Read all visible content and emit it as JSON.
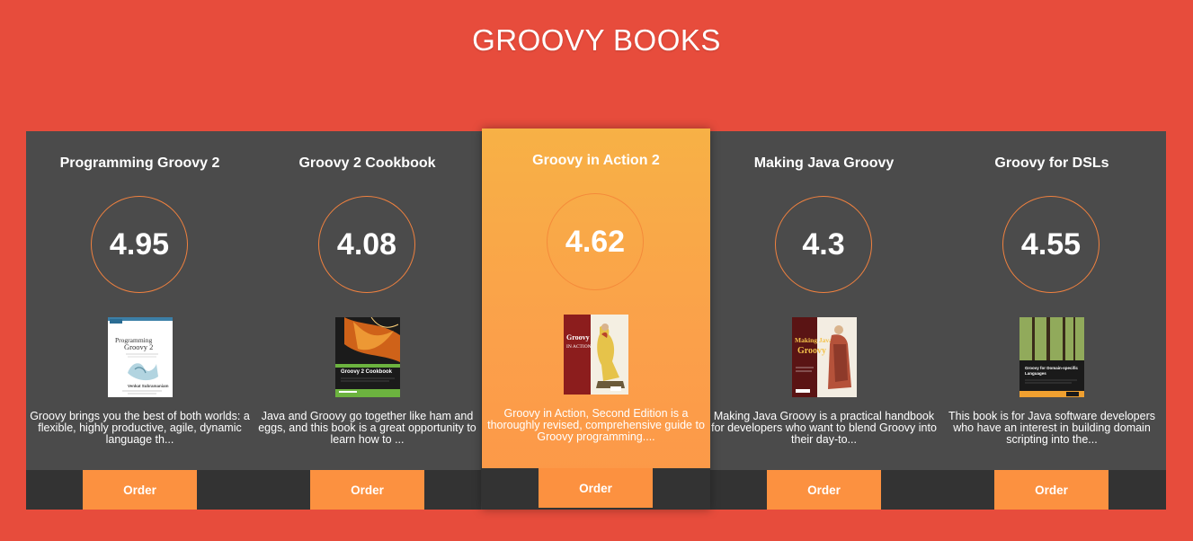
{
  "page": {
    "title": "GROOVY BOOKS"
  },
  "colors": {
    "background": "#e74c3c",
    "card": "#4b4b4b",
    "card_featured_top": "#f7b146",
    "card_featured_bottom": "#fd9748",
    "accent": "#fc9140",
    "bar": "#333333"
  },
  "books": [
    {
      "title": "Programming Groovy 2",
      "rating": "4.95",
      "description": "Groovy brings you the best of both worlds: a flexible, highly productive, agile, dynamic language th...",
      "order_label": "Order",
      "cover": {
        "lines": [
          "Programming",
          "Groovy 2"
        ],
        "author": "Venkat Subramaniam"
      }
    },
    {
      "title": "Groovy 2 Cookbook",
      "rating": "4.08",
      "description": "Java and Groovy go together like ham and eggs, and this book is a great opportunity to learn how to ...",
      "order_label": "Order",
      "cover": {
        "lines": [
          "Groovy 2 Cookbook"
        ]
      }
    },
    {
      "title": "Groovy in Action 2",
      "rating": "4.62",
      "description": "Groovy in Action, Second Edition is a thoroughly revised, comprehensive guide to Groovy programming....",
      "order_label": "Order",
      "cover": {
        "lines": [
          "Groovy",
          "IN ACTION"
        ]
      }
    },
    {
      "title": "Making Java Groovy",
      "rating": "4.3",
      "description": "Making Java Groovy is a practical handbook for developers who want to blend Groovy into their day-to...",
      "order_label": "Order",
      "cover": {
        "lines": [
          "Making Java",
          "Groovy"
        ]
      }
    },
    {
      "title": "Groovy for DSLs",
      "rating": "4.55",
      "description": "This book is for Java software developers who have an interest in building domain scripting into the...",
      "order_label": "Order",
      "cover": {
        "lines": [
          "Groovy for Domain-specific",
          "Languages"
        ]
      }
    }
  ]
}
